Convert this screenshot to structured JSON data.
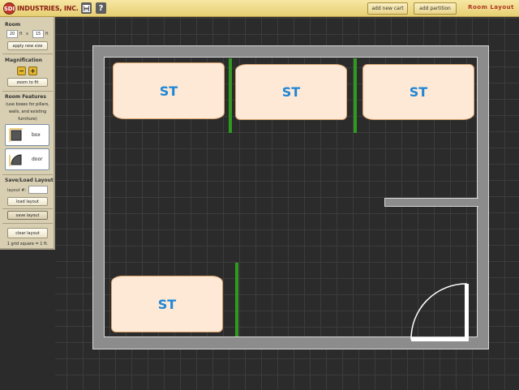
{
  "topbar": {
    "logo_mark": "SDI",
    "logo_text": "INDUSTRIES, INC.",
    "save_icon": "save-icon",
    "help_icon": "help-icon",
    "help_glyph": "?",
    "add_cart_label": "add new cart",
    "add_partition_label": "add partition",
    "app_title": "Room Layout"
  },
  "panel": {
    "room": {
      "title": "Room",
      "width_value": "20",
      "length_value": "15",
      "unit": "ft",
      "by": "x",
      "apply_label": "apply new size"
    },
    "magnification": {
      "title": "Magnification",
      "minus": "−",
      "plus": "+",
      "zoom_fit_label": "zoom to fit"
    },
    "features": {
      "title": "Room Features",
      "note": "(use boxes for pillars, walls, and existing furniture)",
      "box_label": "box",
      "door_label": "door"
    },
    "save_load": {
      "title": "Save/Load Layout",
      "layout_label": "layout #:",
      "layout_value": "",
      "load_label": "load layout",
      "save_label": "save layout"
    },
    "clear_label": "clear layout",
    "grid_note": "1 grid square = 1 ft."
  },
  "carts": [
    {
      "label": "ST"
    },
    {
      "label": "ST"
    },
    {
      "label": "ST"
    },
    {
      "label": "ST"
    }
  ],
  "colors": {
    "wall": "#8c8c8c",
    "partition": "#2e9a1f",
    "cart_fill": "#fde9d6",
    "cart_text": "#1f86d6",
    "toolbar": "#f0dd8e"
  }
}
